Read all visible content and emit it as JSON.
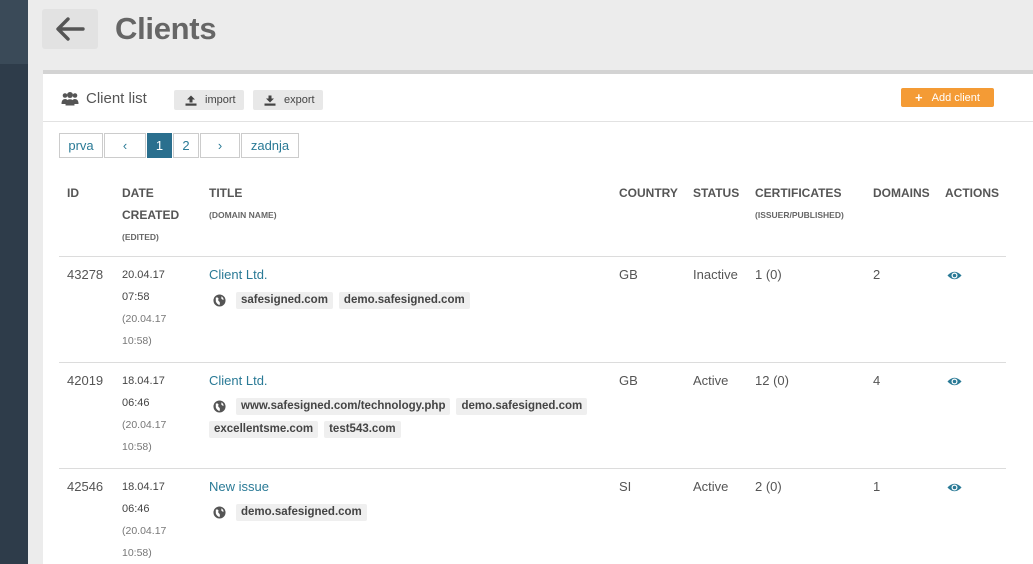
{
  "header": {
    "title": "Clients"
  },
  "panel": {
    "title": "Client list",
    "import_label": "import",
    "export_label": "export",
    "add_label": "Add client"
  },
  "pagination": {
    "first": "prva",
    "prev": "‹",
    "pages": [
      "1",
      "2"
    ],
    "current": "1",
    "next": "›",
    "last": "zadnja"
  },
  "table": {
    "headers": {
      "id": "ID",
      "date_line1": "DATE",
      "date_line2": "CREATED",
      "date_sub": "(EDITED)",
      "title": "TITLE",
      "title_sub": "(DOMAIN NAME)",
      "country": "COUNTRY",
      "status": "STATUS",
      "certificates": "CERTIFICATES",
      "certificates_sub": "(ISSUER/PUBLISHED)",
      "domains": "DOMAINS",
      "actions": "ACTIONS"
    },
    "rows": [
      {
        "id": "43278",
        "created_date": "20.04.17",
        "created_time": "07:58",
        "edited_date": "(20.04.17",
        "edited_time": "10:58)",
        "title": "Client Ltd.",
        "domains": [
          "safesigned.com",
          "demo.safesigned.com"
        ],
        "country": "GB",
        "status": "Inactive",
        "certificates": "1 (0)",
        "domain_count": "2"
      },
      {
        "id": "42019",
        "created_date": "18.04.17",
        "created_time": "06:46",
        "edited_date": "(20.04.17",
        "edited_time": "10:58)",
        "title": "Client Ltd.",
        "domains": [
          "www.safesigned.com/technology.php",
          "demo.safesigned.com",
          "excellentsme.com",
          "test543.com"
        ],
        "country": "GB",
        "status": "Active",
        "certificates": "12 (0)",
        "domain_count": "4"
      },
      {
        "id": "42546",
        "created_date": "18.04.17",
        "created_time": "06:46",
        "edited_date": "(20.04.17",
        "edited_time": "10:58)",
        "title": "New issue",
        "domains": [
          "demo.safesigned.com"
        ],
        "country": "SI",
        "status": "Active",
        "certificates": "2 (0)",
        "domain_count": "1"
      }
    ]
  },
  "icons": {
    "back": "arrow-left-icon",
    "users": "users-icon",
    "upload": "upload-icon",
    "download": "download-icon",
    "globe": "globe-icon",
    "view": "eye-icon"
  },
  "colors": {
    "accent": "#2a7a96",
    "add_button": "#f49b35",
    "active_page": "#2a6f8e",
    "sidebar": "#2e3c4a"
  }
}
